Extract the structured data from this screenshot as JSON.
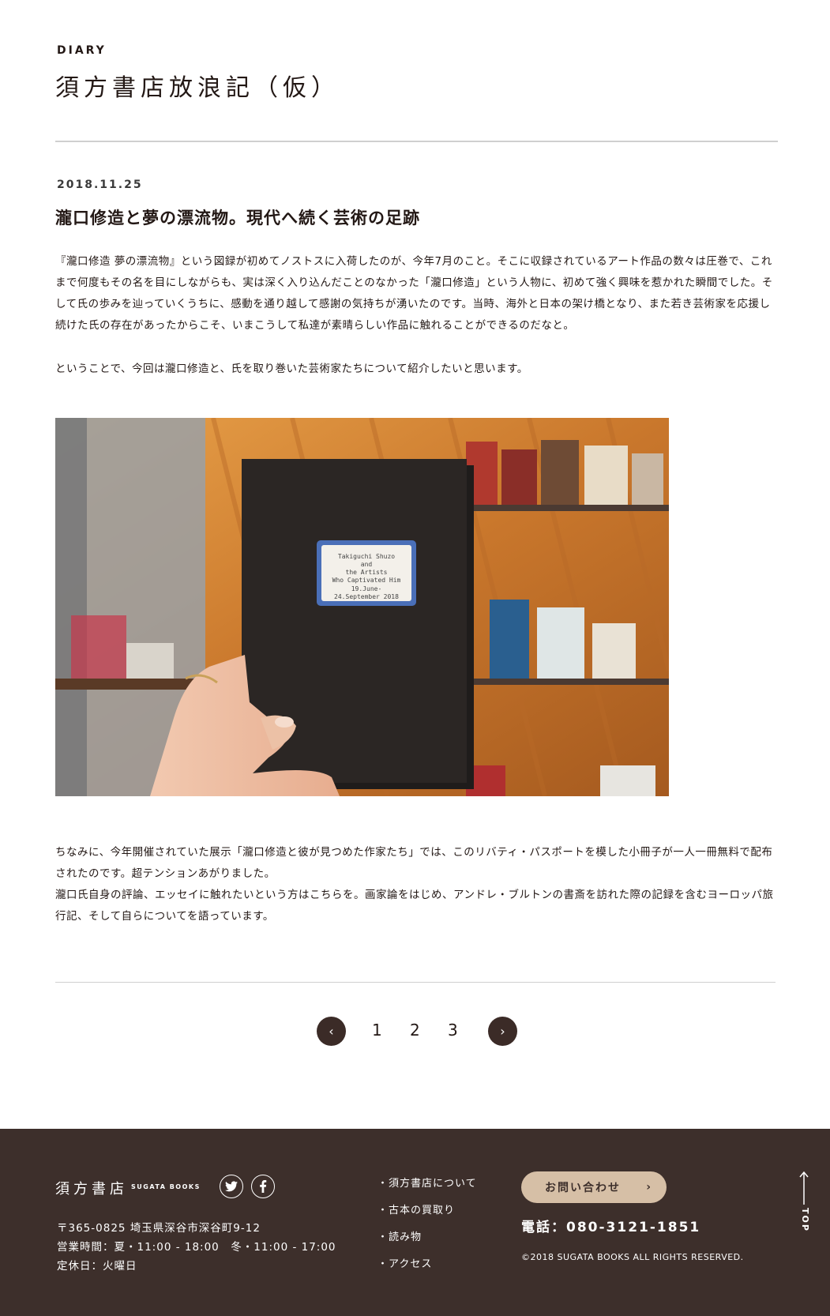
{
  "section": {
    "label": "DIARY",
    "title": "須方書店放浪記（仮）"
  },
  "post": {
    "date": "2018.11.25",
    "title": "瀧口修造と夢の漂流物。現代へ続く芸術の足跡",
    "paragraph1": "『瀧口修造 夢の漂流物』という図録が初めてノストスに入荷したのが、今年7月のこと。そこに収録されているアート作品の数々は圧巻で、これまで何度もその名を目にしながらも、実は深く入り込んだことのなかった「瀧口修造」という人物に、初めて強く興味を惹かれた瞬間でした。そして氏の歩みを辿っていくうちに、感動を通り越して感謝の気持ちが湧いたのです。当時、海外と日本の架け橋となり、また若き芸術家を応援し続けた氏の存在があったからこそ、いまこうして私達が素晴らしい作品に触れることができるのだなと。",
    "paragraph2": "ということで、今回は瀧口修造と、氏を取り巻いた芸術家たちについて紹介したいと思います。",
    "paragraph3a": "ちなみに、今年開催されていた展示「瀧口修造と彼が見つめた作家たち」では、このリバティ・パスポートを模した小冊子が一人一冊無料で配布されたのです。超テンションあがりました。",
    "paragraph3b": "瀧口氏自身の評論、エッセイに触れたいという方はこちらを。画家論をはじめ、アンドレ・ブルトンの書斎を訪れた際の記録を含むヨーロッパ旅行記、そして自らについてを語っています。",
    "photo_label": {
      "line1": "Takiguchi Shuzo",
      "line2": "and",
      "line3": "the Artists",
      "line4": "Who Captivated Him",
      "line5": "19.June-",
      "line6": "24.September 2018"
    }
  },
  "pagination": {
    "prev": "‹",
    "next": "›",
    "pages": [
      "1",
      "2",
      "3"
    ]
  },
  "footer": {
    "logo": "須方書店",
    "logo_sub": "SUGATA BOOKS",
    "twitter_icon": "twitter-icon",
    "facebook_icon": "facebook-icon",
    "address": "〒365-0825 埼玉県深谷市深谷町9-12",
    "hours": "営業時間：夏・11:00 - 18:00　冬・11:00 - 17:00",
    "holiday": "定休日：火曜日",
    "nav": [
      "・須方書店について",
      "・古本の買取り",
      "・読み物",
      "・アクセス"
    ],
    "contact": "お問い合わせ",
    "contact_arrow": "›",
    "phone": "電話：080-3121-1851",
    "copyright": "©2018 SUGATA BOOKS ALL RIGHTS RESERVED.",
    "top": "TOP"
  },
  "colors": {
    "footer_bg": "#3d2f2b",
    "accent": "#d6bfa6",
    "text": "#231815"
  }
}
